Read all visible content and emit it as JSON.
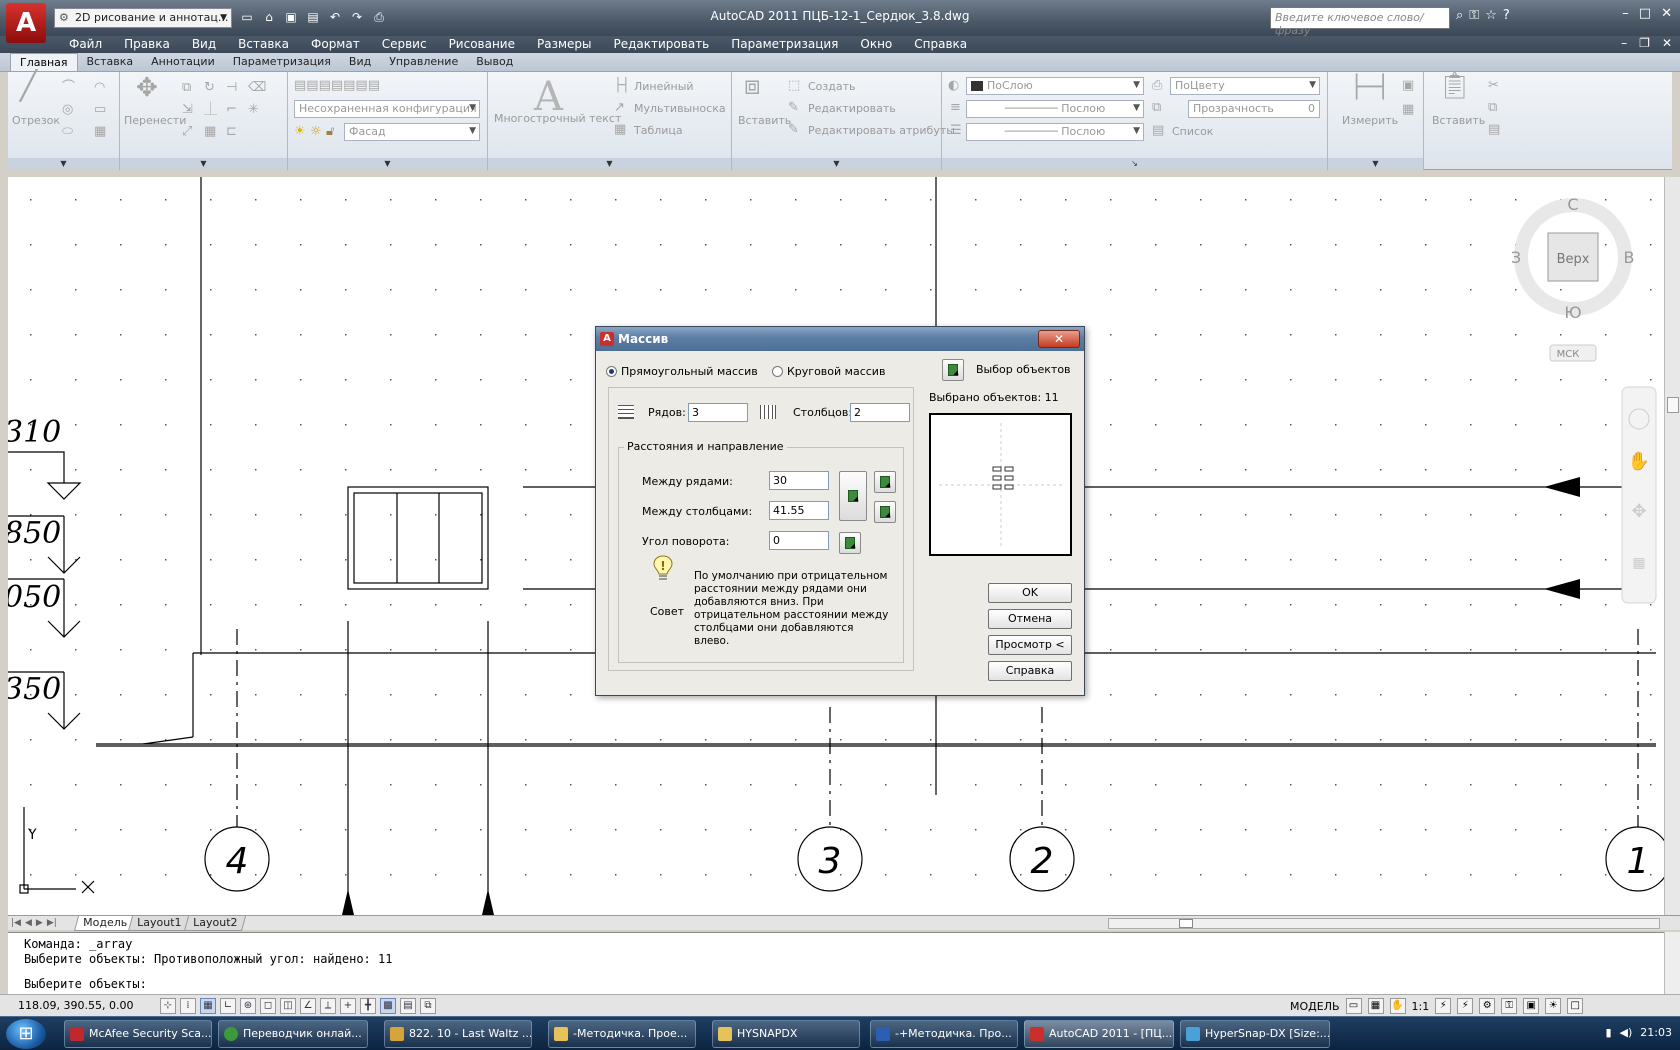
{
  "window": {
    "title": "AutoCAD 2011   ПЦБ-12-1_Сердюк_3.8.dwg",
    "workspace": "2D рисование и аннотац...",
    "search_placeholder": "Введите ключевое слово/фразу"
  },
  "menu": [
    "Файл",
    "Правка",
    "Вид",
    "Вставка",
    "Формат",
    "Сервис",
    "Рисование",
    "Размеры",
    "Редактировать",
    "Параметризация",
    "Окно",
    "Справка"
  ],
  "ribbon_tabs": [
    "Главная",
    "Вставка",
    "Аннотации",
    "Параметризация",
    "Вид",
    "Управление",
    "Вывод"
  ],
  "ribbon": {
    "segment": "Отрезок",
    "move": "Перенести",
    "layer_config": "Несохраненная конфигурация слоев",
    "layer_name": "Фасад",
    "mtext": "Многострочный текст",
    "linear": "Линейный",
    "multileader": "Мультивыноска",
    "table": "Таблица",
    "insert": "Вставить",
    "create": "Создать",
    "edit": "Редактировать",
    "edit_attr": "Редактировать атрибуты",
    "color": "ПоСлою",
    "linetype": "Послою",
    "lineweight": "Послою",
    "plotstyle": "ПоЦвету",
    "transparency_label": "Прозрачность",
    "transparency_value": "0",
    "list": "Список",
    "measure": "Измерить",
    "paste": "Вставить"
  },
  "viewcube": {
    "n": "С",
    "w": "З",
    "e": "В",
    "s": "Ю",
    "face": "Верх",
    "ucs": "МСК"
  },
  "drawing": {
    "elevations": [
      "310",
      "850",
      "050",
      "350"
    ],
    "axes": [
      "4",
      "3",
      "2",
      "1"
    ],
    "ucs_y": "Y"
  },
  "layout_tabs": [
    "Модель",
    "Layout1",
    "Layout2"
  ],
  "command_lines": [
    "Команда: _array",
    "Выберите объекты: Противоположный угол: найдено: 11",
    "Выберите объекты:"
  ],
  "status": {
    "coords": "118.09, 390.55, 0.00",
    "model": "МОДЕЛЬ",
    "scale": "1:1"
  },
  "taskbar": {
    "items": [
      "McAfee Security Sca...",
      "Переводчик онлай...",
      "822. 10 - Last Waltz ...",
      "-Методичка. Прое...",
      "HYSNAPDX",
      "-+Методичка. Про...",
      "AutoCAD 2011 - [ПЦ...",
      "HyperSnap-DX [Size:..."
    ],
    "clock": "21:03"
  },
  "dialog": {
    "title": "Массив",
    "rect_array": "Прямоугольный массив",
    "polar_array": "Круговой массив",
    "select_objects": "Выбор объектов",
    "selected": "Выбрано объектов: 11",
    "rows_label": "Рядов:",
    "rows_value": "3",
    "cols_label": "Столбцов:",
    "cols_value": "2",
    "group_title": "Расстояния и направление",
    "row_offset_label": "Между рядами:",
    "row_offset_value": "30",
    "col_offset_label": "Между столбцами:",
    "col_offset_value": "41.55",
    "angle_label": "Угол поворота:",
    "angle_value": "0",
    "tip_label": "Совет",
    "tip_text": "По умолчанию при отрицательном расстоянии между рядами они добавляются вниз. При отрицательном расстоянии между столбцами они добавляются влево.",
    "ok": "OK",
    "cancel": "Отмена",
    "preview": "Просмотр <",
    "help": "Справка"
  }
}
